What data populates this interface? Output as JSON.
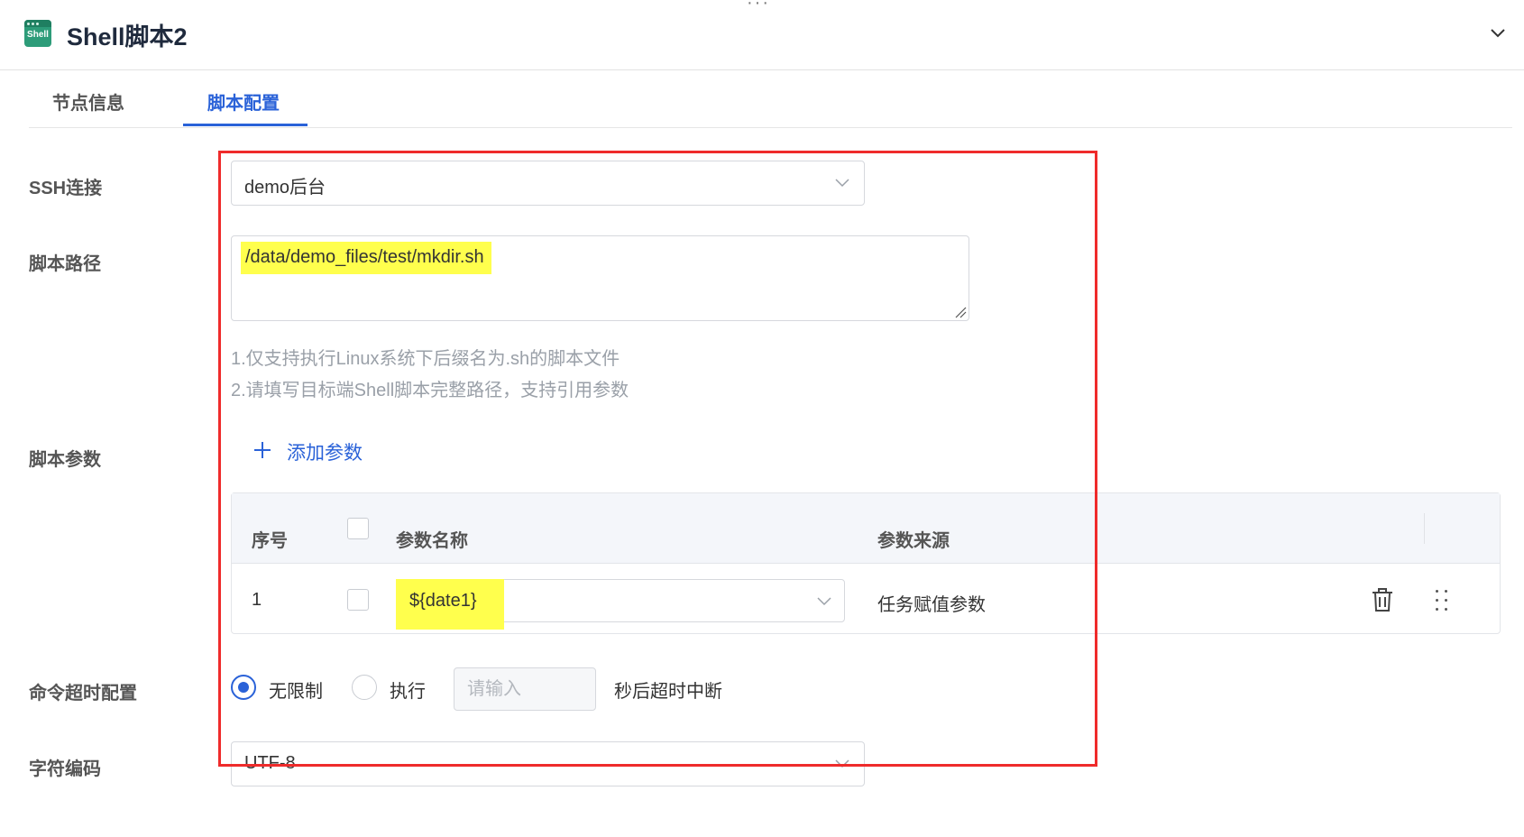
{
  "header": {
    "more_dots": "···",
    "icon_text": "Shell",
    "title": "Shell脚本2"
  },
  "tabs": [
    {
      "label": "节点信息",
      "active": false
    },
    {
      "label": "脚本配置",
      "active": true
    }
  ],
  "form": {
    "ssh": {
      "label": "SSH连接",
      "value": "demo后台"
    },
    "script_path": {
      "label": "脚本路径",
      "value": "/data/demo_files/test/mkdir.sh",
      "hints": [
        "1.仅支持执行Linux系统下后缀名为.sh的脚本文件",
        "2.请填写目标端Shell脚本完整路径，支持引用参数"
      ]
    },
    "params": {
      "label": "脚本参数",
      "add_label": "添加参数",
      "columns": [
        "序号",
        "参数名称",
        "参数来源"
      ],
      "rows": [
        {
          "index": "1",
          "name": "${date1}",
          "source": "任务赋值参数"
        }
      ]
    },
    "timeout": {
      "label": "命令超时配置",
      "option_unlimited": "无限制",
      "option_execute": "执行",
      "input_placeholder": "请输入",
      "suffix": "秒后超时中断",
      "selected": "无限制"
    },
    "encoding": {
      "label": "字符编码",
      "value": "UTF-8"
    }
  },
  "colors": {
    "accent": "#2a62d8",
    "highlight": "#ffff4d",
    "annotation": "#ef2b2b"
  }
}
